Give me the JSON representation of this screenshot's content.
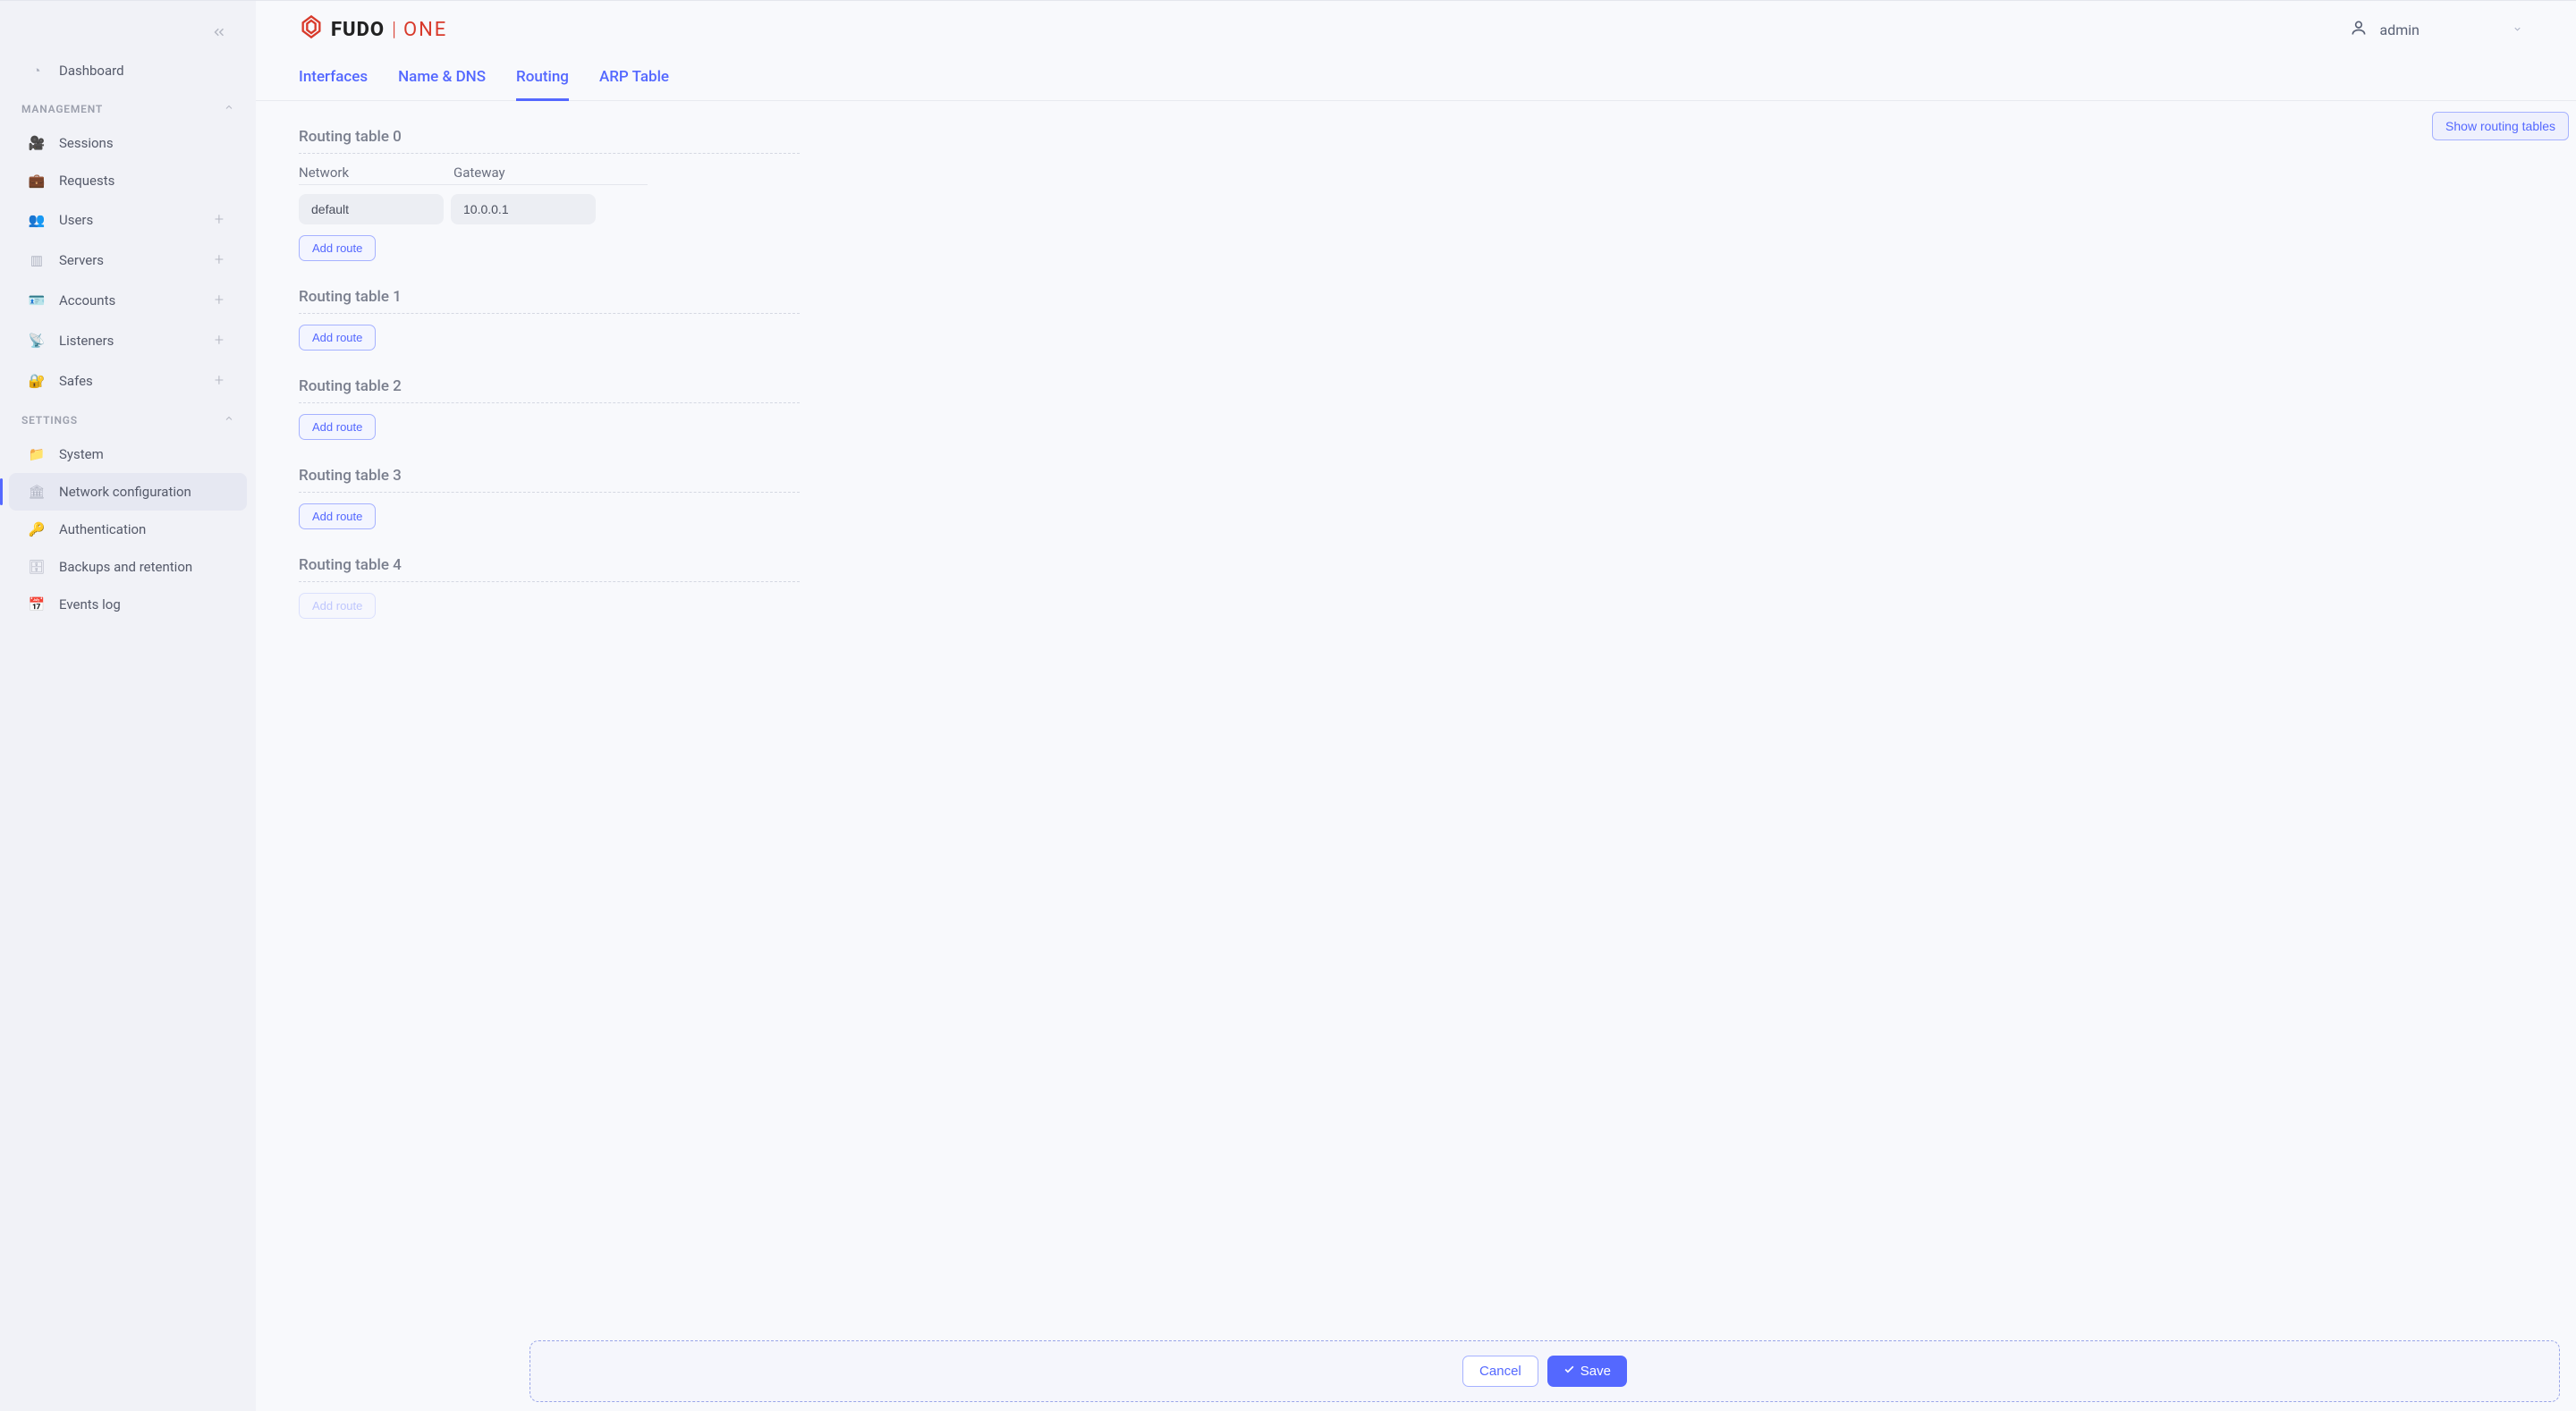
{
  "sidebar": {
    "dashboard_label": "Dashboard",
    "sections": {
      "management": {
        "title": "MANAGEMENT",
        "items": [
          {
            "label": "Sessions",
            "icon": "sessions-icon",
            "plus": false
          },
          {
            "label": "Requests",
            "icon": "requests-icon",
            "plus": false
          },
          {
            "label": "Users",
            "icon": "users-icon",
            "plus": true
          },
          {
            "label": "Servers",
            "icon": "servers-icon",
            "plus": true
          },
          {
            "label": "Accounts",
            "icon": "accounts-icon",
            "plus": true
          },
          {
            "label": "Listeners",
            "icon": "listeners-icon",
            "plus": true
          },
          {
            "label": "Safes",
            "icon": "safes-icon",
            "plus": true
          }
        ]
      },
      "settings": {
        "title": "SETTINGS",
        "items": [
          {
            "label": "System",
            "icon": "folder-icon"
          },
          {
            "label": "Network configuration",
            "icon": "network-icon",
            "active": true
          },
          {
            "label": "Authentication",
            "icon": "key-icon"
          },
          {
            "label": "Backups and retention",
            "icon": "backups-icon"
          },
          {
            "label": "Events log",
            "icon": "calendar-icon"
          }
        ]
      }
    }
  },
  "header": {
    "logo_main": "FUDO",
    "logo_sub": "ONE",
    "user_name": "admin"
  },
  "tabs": [
    {
      "label": "Interfaces",
      "active": false
    },
    {
      "label": "Name & DNS",
      "active": false
    },
    {
      "label": "Routing",
      "active": true
    },
    {
      "label": "ARP Table",
      "active": false
    }
  ],
  "actions": {
    "show_routing_tables": "Show routing tables",
    "add_route": "Add route",
    "cancel": "Cancel",
    "save": "Save"
  },
  "routing": {
    "column_headers": {
      "network": "Network",
      "gateway": "Gateway"
    },
    "tables": [
      {
        "title": "Routing table 0",
        "routes": [
          {
            "network": "default",
            "gateway": "10.0.0.1"
          }
        ]
      },
      {
        "title": "Routing table 1",
        "routes": []
      },
      {
        "title": "Routing table 2",
        "routes": []
      },
      {
        "title": "Routing table 3",
        "routes": []
      },
      {
        "title": "Routing table 4",
        "routes": []
      }
    ]
  }
}
